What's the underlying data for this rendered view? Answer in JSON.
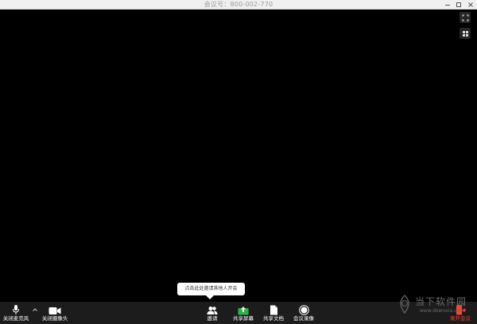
{
  "window": {
    "title": "会议号：800-002-770"
  },
  "tooltip": {
    "text": "点击此处邀请其他人开会"
  },
  "toolbar": {
    "mic_label": "关闭麦克风",
    "camera_label": "关闭摄像头",
    "invite_label": "邀请",
    "share_screen_label": "共享屏幕",
    "share_doc_label": "共享文档",
    "record_label": "会议录像",
    "leave_label": "离开会议"
  },
  "watermark": {
    "title": "当下软件园",
    "url": "www.downxia.com"
  },
  "colors": {
    "background": "#000000",
    "toolbar": "#1c1c1c",
    "share_accent": "#2db34a",
    "leave_accent": "#e64a3b"
  },
  "icons": [
    "minimize-icon",
    "maximize-icon",
    "close-icon",
    "fullscreen-icon",
    "gallery-view-icon",
    "microphone-icon",
    "chevron-up-icon",
    "video-camera-icon",
    "people-icon",
    "share-screen-icon",
    "document-icon",
    "record-icon",
    "exit-icon"
  ]
}
